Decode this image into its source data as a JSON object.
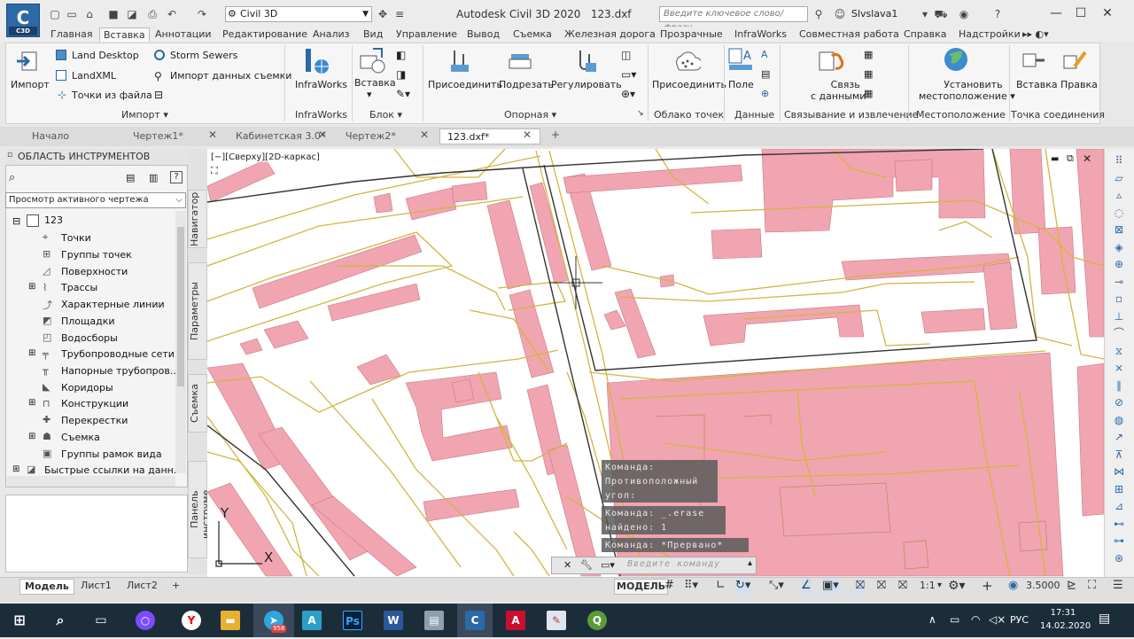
{
  "app": {
    "badge": "C3D",
    "workspace": "Civil 3D",
    "title": "Autodesk Civil 3D 2020",
    "file": "123.dxf",
    "search_placeholder": "Введите ключевое слово/фразу",
    "user": "Slvslava1"
  },
  "ribbon_tabs": [
    "Главная",
    "Вставка",
    "Аннотации",
    "Редактирование",
    "Анализ",
    "Вид",
    "Управление",
    "Вывод",
    "Съемка",
    "Железная дорога",
    "Прозрачные",
    "InfraWorks",
    "Совместная работа",
    "Справка",
    "Надстройки"
  ],
  "ribbon": {
    "import": {
      "main": "Импорт",
      "items": [
        "Land Desktop",
        "Storm Sewers",
        "LandXML",
        "Импорт данных съемки",
        "Точки из файла"
      ],
      "panel": "Импорт"
    },
    "infraworks": {
      "main": "InfraWorks",
      "panel": "InfraWorks"
    },
    "block": {
      "main": "Вставка",
      "panel": "Блок"
    },
    "reference": {
      "attach": "Присоединить",
      "clip": "Подрезать",
      "adjust": "Регулировать",
      "panel": "Опорная"
    },
    "pointcloud": {
      "attach": "Присоединить",
      "panel": "Облако точек"
    },
    "data": {
      "field": "Поле",
      "panel": "Данные"
    },
    "linking": {
      "link_l1": "Связь",
      "link_l2": "с данными",
      "panel": "Связывание и извлечение"
    },
    "location": {
      "set_l1": "Установить",
      "set_l2": "местоположение",
      "panel": "Местоположение"
    },
    "connection": {
      "insert": "Вставка",
      "edit": "Правка",
      "panel": "Точка соединения"
    }
  },
  "doc_tabs": [
    "Начало",
    "Чертеж1*",
    "Кабинетская 3.0*",
    "Чертеж2*",
    "123.dxf*"
  ],
  "tool_palette": {
    "header": "ОБЛАСТЬ ИНСТРУМЕНТОВ",
    "view_select": "Просмотр активного чертежа",
    "root": "123",
    "items": [
      "Точки",
      "Группы точек",
      "Поверхности",
      "Трассы",
      "Характерные линии",
      "Площадки",
      "Водосборы",
      "Трубопроводные сети",
      "Напорные трубопров...",
      "Коридоры",
      "Конструкции",
      "Перекрестки",
      "Съемка",
      "Группы рамок вида"
    ],
    "shortcuts": "Быстрые ссылки на данн...",
    "side_tabs": [
      "Навигатор",
      "Параметры",
      "Съемка",
      "Панель инструме..."
    ]
  },
  "viewport": {
    "label": "[−][Сверху][2D-каркас]",
    "axis_x": "X",
    "axis_y": "Y"
  },
  "command": {
    "history": [
      "Команда:",
      "Противоположный",
      "угол:",
      "Команда:  _.erase",
      "найдено: 1",
      "Команда: *Прервано*"
    ],
    "placeholder": "Введите команду"
  },
  "layout_tabs": [
    "Модель",
    "Лист1",
    "Лист2"
  ],
  "status": {
    "mode": "МОДЕЛЬ",
    "scale": "1:1",
    "value": "3.5000"
  },
  "taskbar": {
    "lang": "РУС",
    "time": "17:31",
    "date": "14.02.2020",
    "telegram_count": "958"
  },
  "colors": {
    "building": "#f0a5b0",
    "road": "#d4b440",
    "line": "#333333",
    "accent": "#2b6aa6"
  }
}
